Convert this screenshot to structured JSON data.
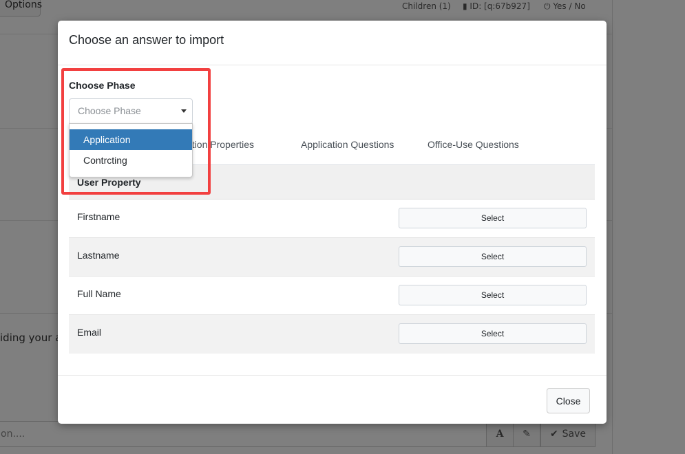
{
  "background": {
    "options_button": "Options",
    "children_label": "Children (1)",
    "id_label": "ID: [q:67b927]",
    "yes_no_label": "Yes / No",
    "hiding_text": "iding your a",
    "bottom_input_placeholder": "on....",
    "save_label": "Save"
  },
  "modal": {
    "title": "Choose an answer to import",
    "phase_label": "Choose Phase",
    "phase_placeholder": "Choose Phase",
    "phase_options": [
      "Application",
      "Contrcting"
    ],
    "tabs": [
      "plication Properties",
      "Application Questions",
      "Office-Use Questions"
    ],
    "table": {
      "header": "User Property",
      "rows": [
        {
          "label": "Firstname",
          "action": "Select"
        },
        {
          "label": "Lastname",
          "action": "Select"
        },
        {
          "label": "Full Name",
          "action": "Select"
        },
        {
          "label": "Email",
          "action": "Select"
        }
      ]
    },
    "close_label": "Close"
  },
  "colors": {
    "highlight": "#f24040",
    "selected_option": "#337ab7"
  }
}
